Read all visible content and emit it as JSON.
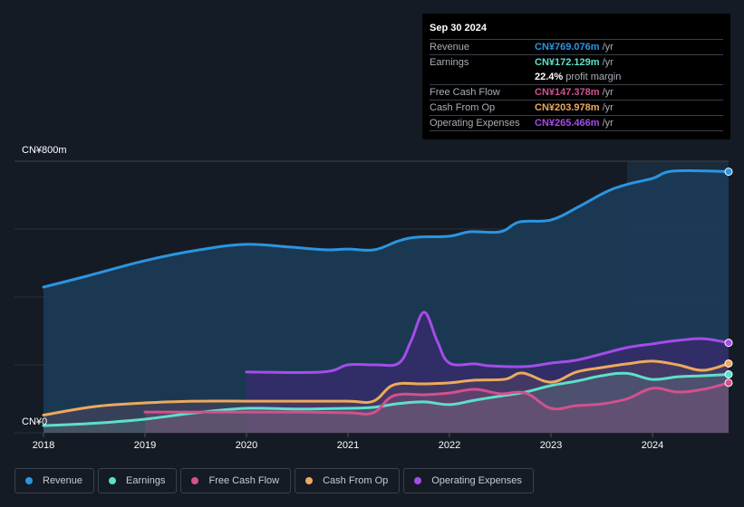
{
  "tooltip": {
    "date": "Sep 30 2024",
    "rows": [
      {
        "label": "Revenue",
        "value": "CN¥769.076m",
        "unit": "/yr",
        "color": "#2b95e0"
      },
      {
        "label": "Earnings",
        "value": "CN¥172.129m",
        "unit": "/yr",
        "color": "#5de0c9"
      },
      {
        "label": "",
        "value": "22.4%",
        "unit": "profit margin",
        "color": "#ffffff"
      },
      {
        "label": "Free Cash Flow",
        "value": "CN¥147.378m",
        "unit": "/yr",
        "color": "#d2518f"
      },
      {
        "label": "Cash From Op",
        "value": "CN¥203.978m",
        "unit": "/yr",
        "color": "#eda95e"
      },
      {
        "label": "Operating Expenses",
        "value": "CN¥265.466m",
        "unit": "/yr",
        "color": "#a44de8"
      }
    ]
  },
  "legend": [
    {
      "label": "Revenue",
      "color": "#2b95e0",
      "icon": "dot-icon"
    },
    {
      "label": "Earnings",
      "color": "#5de0c9",
      "icon": "dot-icon"
    },
    {
      "label": "Free Cash Flow",
      "color": "#d2518f",
      "icon": "dot-icon"
    },
    {
      "label": "Cash From Op",
      "color": "#eda95e",
      "icon": "dot-icon"
    },
    {
      "label": "Operating Expenses",
      "color": "#a44de8",
      "icon": "dot-icon"
    }
  ],
  "chart_data": {
    "type": "area",
    "title": "",
    "xlabel": "",
    "ylabel": "",
    "y_top_label": "CN¥800m",
    "y_bottom_label": "CN¥0",
    "ylim": [
      0,
      800
    ],
    "xlim": [
      2018.0,
      2024.75
    ],
    "x_ticks": [
      2018,
      2019,
      2020,
      2021,
      2022,
      2023,
      2024
    ],
    "x_tick_labels": [
      "2018",
      "2019",
      "2020",
      "2021",
      "2022",
      "2023",
      "2024"
    ],
    "grid": true,
    "highlight_from": 2023.75,
    "series": [
      {
        "name": "Revenue",
        "color": "#2b95e0",
        "x": [
          2018.0,
          2018.46,
          2019.0,
          2019.54,
          2020.0,
          2020.43,
          2020.79,
          2021.0,
          2021.26,
          2021.5,
          2021.68,
          2022.0,
          2022.2,
          2022.5,
          2022.69,
          2023.0,
          2023.28,
          2023.54,
          2023.74,
          2024.0,
          2024.21,
          2024.75
        ],
        "values": [
          429,
          464,
          507,
          539,
          555,
          547,
          539,
          541,
          539,
          565,
          576,
          579,
          592,
          592,
          621,
          627,
          667,
          709,
          731,
          749,
          771,
          769
        ]
      },
      {
        "name": "Operating Expenses",
        "color": "#a44de8",
        "x": [
          2020.0,
          2020.75,
          2021.0,
          2021.28,
          2021.5,
          2021.62,
          2021.75,
          2021.88,
          2022.0,
          2022.25,
          2022.4,
          2022.75,
          2023.0,
          2023.25,
          2023.5,
          2023.75,
          2024.0,
          2024.25,
          2024.5,
          2024.75
        ],
        "values": [
          179,
          179,
          200,
          200,
          205,
          269,
          355,
          269,
          205,
          203,
          197,
          195,
          205,
          214,
          232,
          251,
          262,
          272,
          277,
          265
        ]
      },
      {
        "name": "Cash From Op",
        "color": "#eda95e",
        "x": [
          2018.0,
          2018.5,
          2019.0,
          2019.5,
          2020.0,
          2020.5,
          2021.0,
          2021.25,
          2021.45,
          2021.75,
          2022.0,
          2022.25,
          2022.55,
          2022.72,
          2023.0,
          2023.25,
          2023.5,
          2023.75,
          2024.0,
          2024.25,
          2024.5,
          2024.75
        ],
        "values": [
          52,
          77,
          88,
          93,
          93,
          93,
          93,
          93,
          141,
          144,
          147,
          155,
          158,
          176,
          149,
          179,
          192,
          203,
          211,
          200,
          184,
          204
        ]
      },
      {
        "name": "Earnings",
        "color": "#5de0c9",
        "x": [
          2018.0,
          2018.5,
          2019.0,
          2019.5,
          2020.0,
          2020.5,
          2021.0,
          2021.25,
          2021.5,
          2021.75,
          2022.0,
          2022.25,
          2022.5,
          2022.75,
          2023.0,
          2023.25,
          2023.5,
          2023.75,
          2024.0,
          2024.25,
          2024.5,
          2024.75
        ],
        "values": [
          21,
          28,
          40,
          59,
          72,
          70,
          72,
          75,
          86,
          91,
          83,
          96,
          108,
          120,
          139,
          152,
          168,
          175,
          157,
          165,
          168,
          172
        ]
      },
      {
        "name": "Free Cash Flow",
        "color": "#d2518f",
        "x": [
          2019.0,
          2019.5,
          2020.0,
          2020.5,
          2021.0,
          2021.25,
          2021.45,
          2021.75,
          2022.0,
          2022.25,
          2022.5,
          2022.75,
          2023.0,
          2023.25,
          2023.5,
          2023.75,
          2024.0,
          2024.25,
          2024.5,
          2024.75
        ],
        "values": [
          61,
          61,
          61,
          61,
          59,
          59,
          109,
          112,
          117,
          128,
          115,
          117,
          72,
          80,
          85,
          100,
          131,
          120,
          128,
          147
        ]
      }
    ]
  }
}
